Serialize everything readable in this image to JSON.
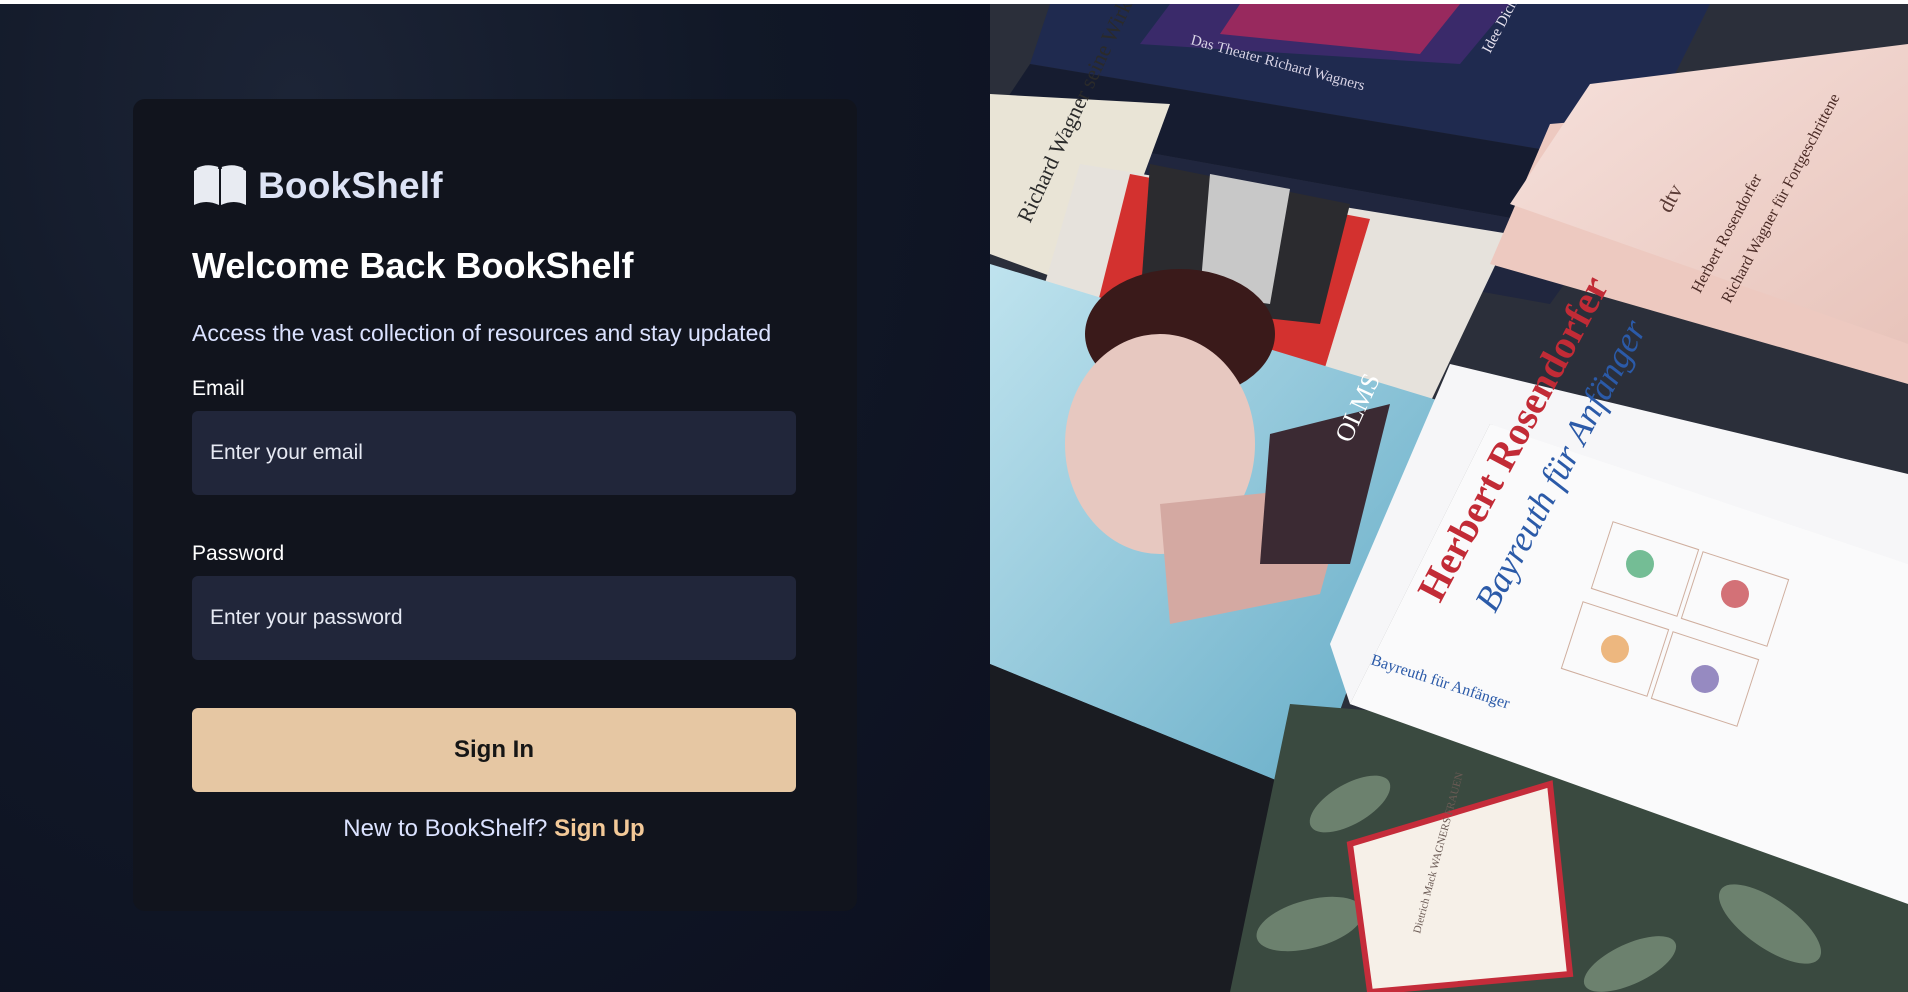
{
  "brand": {
    "name": "BookShelf",
    "icon": "open-book-icon"
  },
  "login": {
    "title": "Welcome Back BookShelf",
    "subtitle": "Access the vast collection of resources and stay updated",
    "email_label": "Email",
    "email_placeholder": "Enter your email",
    "email_value": "",
    "password_label": "Password",
    "password_placeholder": "Enter your password",
    "password_value": "",
    "submit_label": "Sign In",
    "signup_prompt": "New to BookShelf? ",
    "signup_link": "Sign Up"
  },
  "photo": {
    "texts": {
      "wagner_tag": "Das Theater Richard Wagners",
      "ideal_tag": "Idee Dichtung Wirkung",
      "fischer_title": "Richard Wagner seine Wirkung",
      "olms": "OLMS",
      "dtv": "dtv",
      "pink_author": "Herbert Rosendorfer",
      "pink_title": "Richard Wagner für Fortgeschrittene",
      "white_author": "Herbert Rosendorfer",
      "white_title": "Bayreuth für Anfänger",
      "spine_text": "Bayreuth für Anfänger",
      "label_text": "Dietrich Mack WAGNERS FRAUEN"
    }
  },
  "colors": {
    "accent": "#e6c7a3",
    "link": "#f3c998",
    "card_bg": "#11141d",
    "input_bg": "#21263a",
    "page_bg": "#111827"
  }
}
